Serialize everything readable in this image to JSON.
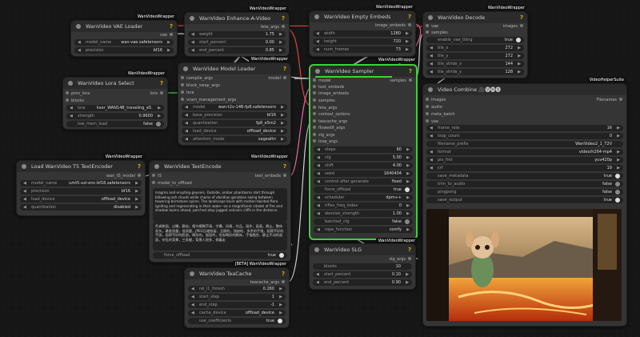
{
  "vae_loader": {
    "wrapper": "WanVideoWrapper",
    "title": "WanVideo VAE Loader",
    "out": "vae",
    "widgets": [
      {
        "label": "model_name",
        "value": "wan-vae.safetensors"
      },
      {
        "label": "precision",
        "value": "bf16"
      }
    ]
  },
  "enhance": {
    "wrapper": "WanVideoWrapper",
    "title": "WanVideo Enhance-A-Video",
    "out": "feta_args",
    "widgets": [
      {
        "label": "weight",
        "value": "1.75"
      },
      {
        "label": "start_percent",
        "value": "0.00"
      },
      {
        "label": "end_percent",
        "value": "0.85"
      }
    ]
  },
  "embeds": {
    "wrapper": "WanVideoWrapper",
    "title": "WanVideo Empty Embeds",
    "out": "image_embeds",
    "widgets": [
      {
        "label": "width",
        "value": "1280"
      },
      {
        "label": "height",
        "value": "720"
      },
      {
        "label": "num_frames",
        "value": "73"
      }
    ]
  },
  "decode": {
    "wrapper": "WanVideoWrapper",
    "title": "WanVideo Decode",
    "in1": "vae",
    "in2": "samples",
    "out": "images",
    "widgets": [
      {
        "label": "enable_vae_tiling",
        "value": "true"
      },
      {
        "label": "tile_x",
        "value": "272"
      },
      {
        "label": "tile_y",
        "value": "272"
      },
      {
        "label": "tile_stride_x",
        "value": "144"
      },
      {
        "label": "tile_stride_y",
        "value": "128"
      }
    ]
  },
  "model_loader": {
    "wrapper": "WanVideoWrapper",
    "title": "WanVideo Model Loader",
    "out": "model",
    "inputs": [
      "compile_args",
      "block_swap_args",
      "lora",
      "vram_management_args"
    ],
    "widgets": [
      {
        "label": "model",
        "value": "wan-t2v-14B-fp8.safetensors"
      },
      {
        "label": "base_precision",
        "value": "bf16"
      },
      {
        "label": "quantization",
        "value": "fp8_e5m2"
      },
      {
        "label": "load_device",
        "value": "offload_device"
      },
      {
        "label": "attention_mode",
        "value": "sageattn"
      }
    ]
  },
  "lora": {
    "wrapper": "WanVideoWrapper",
    "title": "WanVideo Lora Select",
    "out": "lora",
    "inputs": [
      "prev_lora",
      "blocks"
    ],
    "widgets": [
      {
        "label": "lora",
        "value": "ksor_WAN14B_traveling_e5.safetensors"
      },
      {
        "label": "strength",
        "value": "0.9600"
      },
      {
        "label": "low_mem_load",
        "value": "false"
      }
    ]
  },
  "sampler": {
    "wrapper": "WanVideoWrapper",
    "title": "WanVideo Sampler",
    "out": "samples",
    "inputs": [
      "model",
      "text_embeds",
      "image_embeds",
      "samples",
      "feta_args",
      "context_options",
      "teacache_args",
      "flowedit_args",
      "slg_args",
      "loop_args"
    ],
    "widgets": [
      {
        "label": "steps",
        "value": "60"
      },
      {
        "label": "cfg",
        "value": "5.00"
      },
      {
        "label": "shift",
        "value": "4.00"
      },
      {
        "label": "seed",
        "value": "1640404"
      },
      {
        "label": "control after generate",
        "value": "fixed"
      },
      {
        "label": "force_offload",
        "value": "true"
      },
      {
        "label": "scheduler",
        "value": "dpm++"
      },
      {
        "label": "riflex_freq_index",
        "value": "0"
      },
      {
        "label": "denoise_strength",
        "value": "1.00"
      },
      {
        "label": "batched_cfg",
        "value": "false"
      },
      {
        "label": "rope_function",
        "value": "comfy"
      }
    ]
  },
  "combine": {
    "wrapper": "VideoHelperSuite",
    "title": "Video Combine 🎥🅥🅗🅢",
    "out": "Filenames",
    "inputs": [
      "images",
      "audio",
      "meta_batch",
      "vae"
    ],
    "widgets": [
      {
        "label": "frame_rate",
        "value": "16"
      },
      {
        "label": "loop_count",
        "value": "0"
      },
      {
        "label": "filename_prefix",
        "value": "WanVideo2_1_T2V"
      },
      {
        "label": "format",
        "value": "video/h264-mp4"
      },
      {
        "label": "pix_fmt",
        "value": "yuv420p"
      },
      {
        "label": "crf",
        "value": "19"
      },
      {
        "label": "save_metadata",
        "value": "true"
      },
      {
        "label": "trim_to_audio",
        "value": "false"
      },
      {
        "label": "pingpong",
        "value": "false"
      },
      {
        "label": "save_output",
        "value": "true"
      }
    ]
  },
  "t5loader": {
    "wrapper": "WanVideoWrapper",
    "title": "Load WanVideo T5 TextEncoder",
    "out": "wan_t5_model",
    "widgets": [
      {
        "label": "model_name",
        "value": "umt5-xxl-enc-bf16.safetensors"
      },
      {
        "label": "precision",
        "value": "bf16"
      },
      {
        "label": "load_device",
        "value": "offload_device"
      },
      {
        "label": "quantization",
        "value": "disabled"
      }
    ]
  },
  "textencode": {
    "wrapper": "WanVideoWrapper",
    "title": "WanVideo TextEncode",
    "out": "text_embeds",
    "inputs": [
      "t5",
      "model_to_offload"
    ],
    "prompt": "magma and erupting geysers. Outside, amber phantasms dart through billowing ash clouds while chains of obsidian gondolas swing between towering brimstone spires. The landscape blurs with motion-twisted flora igniting and regenerating in their wake—as a magnificent citadel of fire and shadow looms ahead, perched atop jagged volcanic cliffs in the distance.",
    "negative": "色调艳丽，过曝，静态，细节模糊不清，字幕，风格，作品，画作，画面，静止，整体发灰，最差质量，低质量，JPEG压缩残留，丑陋的，残缺的，多余的手指，画得不好的手部，画得不好的脸部，畸形的，毁容的，形态畸形的肢体，手指融合，静止不动的画面，杂乱的背景，三条腿，背景人很多，倒着走",
    "widgets": [
      {
        "label": "force_offload",
        "value": "true"
      }
    ]
  },
  "teacache": {
    "wrapper": "[BETA] WanVideoWrapper",
    "title": "WanVideo TeaCache",
    "out": "teacache_args",
    "widgets": [
      {
        "label": "rel_l1_thresh",
        "value": "0.260"
      },
      {
        "label": "start_step",
        "value": "1"
      },
      {
        "label": "end_step",
        "value": "-1"
      },
      {
        "label": "cache_device",
        "value": "offload_device"
      },
      {
        "label": "use_coefficients",
        "value": "true"
      }
    ]
  },
  "slg": {
    "wrapper": "WanVideoWrapper",
    "title": "WanVideo SLG",
    "out": "slg_args",
    "widgets": [
      {
        "label": "blocks",
        "value": "10"
      },
      {
        "label": "start_percent",
        "value": "0.10"
      },
      {
        "label": "end_percent",
        "value": "0.90"
      }
    ]
  },
  "colors": {
    "canvas": "#161616",
    "node": "#353535",
    "selected": "#3bd23b",
    "link_pink": "#e26aa0",
    "link_white": "#cfcfcf",
    "link_green": "#4fc24f",
    "link_red": "#d84545"
  }
}
